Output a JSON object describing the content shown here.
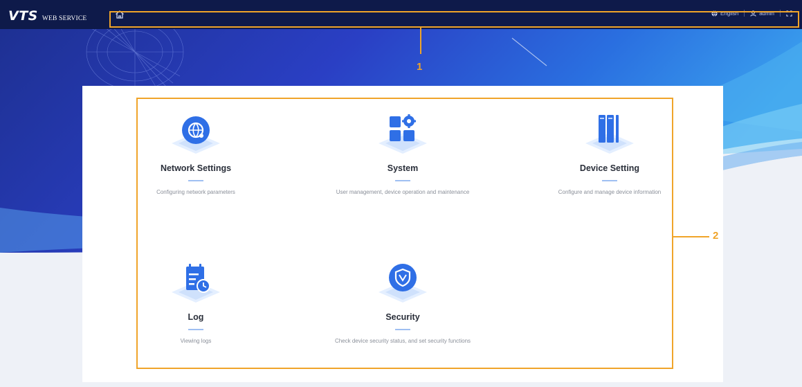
{
  "header": {
    "logo": "VTS",
    "logo_sub": "WEB SERVICE",
    "language": "English",
    "user": "admin"
  },
  "icons": [
    "home-icon",
    "globe-icon",
    "user-icon",
    "fullscreen-icon",
    "network-icon",
    "system-icon",
    "device-icon",
    "log-icon",
    "security-icon"
  ],
  "annotations": {
    "label_1": "1",
    "label_2": "2"
  },
  "tiles": [
    {
      "title": "Network Settings",
      "desc": "Configuring network parameters"
    },
    {
      "title": "System",
      "desc": "User management, device operation and maintenance"
    },
    {
      "title": "Device Setting",
      "desc": "Configure and manage device information"
    },
    {
      "title": "Log",
      "desc": "Viewing logs"
    },
    {
      "title": "Security",
      "desc": "Check device security status, and set security functions"
    }
  ],
  "colors": {
    "accent_blue": "#2f6fe6",
    "annotation": "#f0a429",
    "topbar": "#0e1a4a"
  }
}
